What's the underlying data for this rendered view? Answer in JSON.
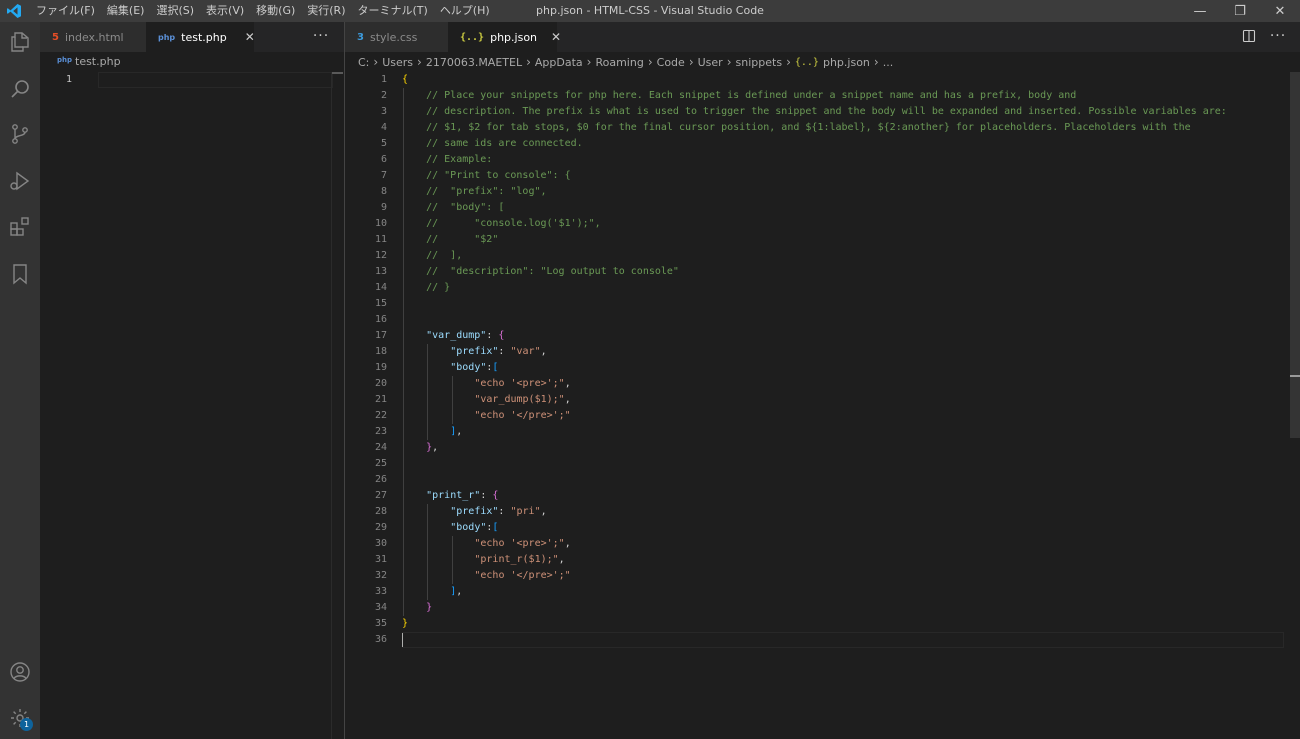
{
  "window": {
    "title": "php.json - HTML-CSS - Visual Studio Code",
    "menu": [
      "ファイル(F)",
      "編集(E)",
      "選択(S)",
      "表示(V)",
      "移動(G)",
      "実行(R)",
      "ターミナル(T)",
      "ヘルプ(H)"
    ],
    "controls": {
      "minimize": "—",
      "restore": "❐",
      "close": "✕"
    }
  },
  "activity_bar": {
    "icons": [
      "explorer-icon",
      "search-icon",
      "source-control-icon",
      "run-debug-icon",
      "extensions-icon",
      "bookmarks-icon",
      "account-icon",
      "settings-gear-icon"
    ],
    "settings_badge": "1"
  },
  "left_group": {
    "tabs": [
      {
        "label": "index.html",
        "icon": "html5-icon",
        "icon_glyph": "5",
        "active": false
      },
      {
        "label": "test.php",
        "icon": "php-icon",
        "icon_glyph": "php",
        "active": true,
        "close": "✕"
      }
    ],
    "more": "···",
    "breadcrumb": "test.php",
    "line_number": "1"
  },
  "right_group": {
    "tabs": [
      {
        "label": "style.css",
        "icon": "css3-icon",
        "icon_glyph": "3",
        "active": false
      },
      {
        "label": "php.json",
        "icon": "json-icon",
        "icon_glyph": "{..}",
        "active": true,
        "close": "✕"
      }
    ],
    "split": "split-editor-icon",
    "more": "···",
    "breadcrumb": [
      "C:",
      "Users",
      "2170063.MAETEL",
      "AppData",
      "Roaming",
      "Code",
      "User",
      "snippets",
      "php.json",
      "..."
    ],
    "breadcrumb_json_icon": "{..}"
  },
  "code": {
    "line_numbers": [
      "1",
      "2",
      "3",
      "4",
      "5",
      "6",
      "7",
      "8",
      "9",
      "10",
      "11",
      "12",
      "13",
      "14",
      "15",
      "16",
      "17",
      "18",
      "19",
      "20",
      "21",
      "22",
      "23",
      "24",
      "25",
      "26",
      "27",
      "28",
      "29",
      "30",
      "31",
      "32",
      "33",
      "34",
      "35",
      "36"
    ],
    "lines": [
      "{",
      "    // Place your snippets for php here. Each snippet is defined under a snippet name and has a prefix, body and",
      "    // description. The prefix is what is used to trigger the snippet and the body will be expanded and inserted. Possible variables are:",
      "    // $1, $2 for tab stops, $0 for the final cursor position, and ${1:label}, ${2:another} for placeholders. Placeholders with the",
      "    // same ids are connected.",
      "    // Example:",
      "    // \"Print to console\": {",
      "    //  \"prefix\": \"log\",",
      "    //  \"body\": [",
      "    //      \"console.log('$1');\",",
      "    //      \"$2\"",
      "    //  ],",
      "    //  \"description\": \"Log output to console\"",
      "    // }",
      "",
      "",
      "    \"var_dump\": {",
      "        \"prefix\": \"var\",",
      "        \"body\":[",
      "            \"echo '<pre>';\",",
      "            \"var_dump($1);\",",
      "            \"echo '</pre>';\"",
      "        ],",
      "    },",
      "",
      "",
      "    \"print_r\": {",
      "        \"prefix\": \"pri\",",
      "        \"body\":[",
      "            \"echo '<pre>';\",",
      "            \"print_r($1);\",",
      "            \"echo '</pre>';\"",
      "        ],",
      "    }",
      "}",
      ""
    ]
  },
  "colors": {
    "comment": "#6a9955",
    "key": "#9cdcfe",
    "string": "#ce9178",
    "brace_level1": "#ffd700",
    "brace_level2": "#da70d6",
    "brace_level3": "#179fff"
  }
}
